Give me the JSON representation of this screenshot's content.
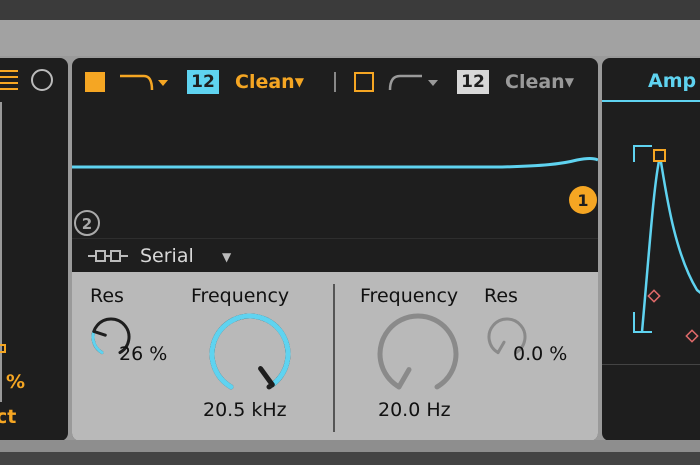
{
  "left_panel": {
    "amount_suffix": "%",
    "transpose_suffix": "ct"
  },
  "filter1": {
    "slope": "12",
    "circuit": "Clean",
    "res_label": "Res",
    "res_value": "26 %",
    "res_level": 0.26,
    "freq_label": "Frequency",
    "freq_value": "20.5 kHz",
    "freq_level": 0.98,
    "badge": "1"
  },
  "filter2": {
    "slope": "12",
    "circuit": "Clean",
    "freq_label": "Frequency",
    "freq_value": "20.0 Hz",
    "freq_level": 0.0,
    "res_label": "Res",
    "res_value": "0.0 %",
    "res_level": 0.0,
    "badge": "2"
  },
  "routing": {
    "mode": "Serial"
  },
  "right_panel": {
    "tab_label": "Amp"
  },
  "colors": {
    "accent_orange": "#f5a623",
    "accent_cyan": "#5fd3f0",
    "panel_bg": "#1e1e1e",
    "controls_bg": "#b9b9b9"
  }
}
